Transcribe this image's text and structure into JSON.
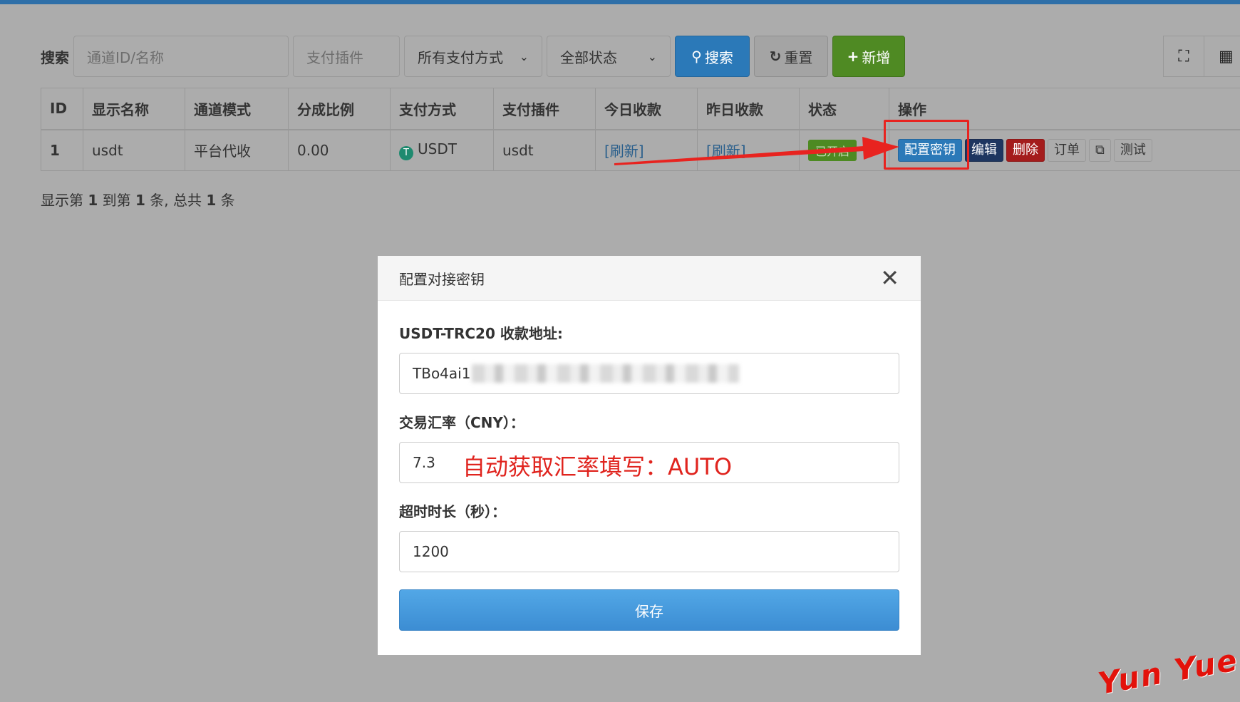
{
  "toolbar": {
    "search_label": "搜索",
    "channel_placeholder": "通道ID/名称",
    "plugin_placeholder": "支付插件",
    "pay_method_selected": "所有支付方式",
    "status_selected": "全部状态",
    "search_button": "搜索",
    "reset_button": "重置",
    "add_button": "新增"
  },
  "table": {
    "headers": [
      "ID",
      "显示名称",
      "通道模式",
      "分成比例",
      "支付方式",
      "支付插件",
      "今日收款",
      "昨日收款",
      "状态",
      "操作"
    ],
    "row": {
      "id": "1",
      "name": "usdt",
      "mode": "平台代收",
      "ratio": "0.00",
      "pay_method": "USDT",
      "plugin": "usdt",
      "today": "[刷新]",
      "yesterday": "[刷新]",
      "status": "已开启",
      "ops": {
        "config_key": "配置密钥",
        "edit": "编辑",
        "delete": "删除",
        "orders": "订单",
        "test": "测试"
      }
    }
  },
  "pager": {
    "prefix": "显示第",
    "start": "1",
    "mid1": "到第",
    "end": "1",
    "mid2": "条, 总共",
    "total": "1",
    "suffix": "条"
  },
  "modal": {
    "title": "配置对接密钥",
    "address_label": "USDT-TRC20 收款地址:",
    "address_value": "TBo4ai1",
    "rate_label": "交易汇率（CNY）：",
    "rate_value": "7.3",
    "rate_annotation": "自动获取汇率填写：AUTO",
    "timeout_label": "超时时长（秒）：",
    "timeout_value": "1200",
    "save_button": "保存"
  },
  "watermark": "Yun Yue",
  "colors": {
    "primary": "#2b79b8",
    "success": "#4f8a23",
    "danger": "#a41c1c",
    "annotation": "#e0241e"
  }
}
